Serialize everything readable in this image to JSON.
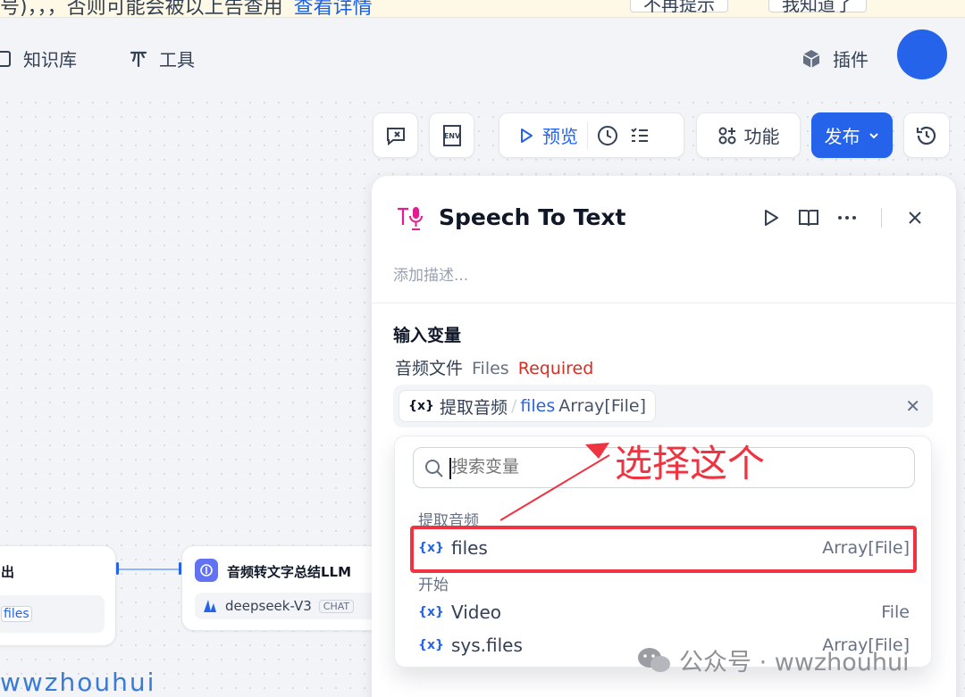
{
  "banner": {
    "text": "号)，，，否则可能会被以上告查用",
    "link": "查看详情",
    "btn1": "不再提示",
    "btn2": "我知道了"
  },
  "nav": {
    "knowledge": "知识库",
    "tools": "工具",
    "plugins": "插件"
  },
  "toolbar": {
    "preview": "预览",
    "features": "功能",
    "publish": "发布"
  },
  "nodes": {
    "left_title": "出",
    "left_tag": "files",
    "llm_title": "音频转文字总结LLM",
    "llm_model": "deepseek-V3",
    "llm_badge": "CHAT"
  },
  "panel": {
    "title": "Speech To Text",
    "description_placeholder": "添加描述...",
    "section_title": "输入变量",
    "field_name": "音频文件",
    "field_type": "Files",
    "field_required": "Required",
    "chip_node": "提取音频",
    "chip_sep": "/",
    "chip_var": "files",
    "chip_type": "Array[File]"
  },
  "dropdown": {
    "search_placeholder": "搜索变量",
    "groups": [
      {
        "label": "提取音频",
        "options": [
          {
            "icon": "{x}",
            "name": "files",
            "type": "Array[File]"
          }
        ]
      },
      {
        "label": "开始",
        "options": [
          {
            "icon": "{x}",
            "name": "Video",
            "type": "File"
          },
          {
            "icon": "{x}",
            "name": "sys.files",
            "type": "Array[File]"
          }
        ]
      }
    ]
  },
  "annotation": {
    "text": "选择这个"
  },
  "watermark": {
    "text": "公众号 · wwzhouhui",
    "handle": "wwzhouhui"
  },
  "colors": {
    "accent": "#2563eb",
    "annotation": "#ef3340",
    "required": "#d92d20"
  }
}
